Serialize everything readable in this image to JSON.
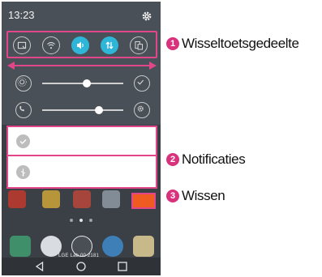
{
  "status_bar": {
    "time": "13:23"
  },
  "quick_settings": {
    "toggles": [
      {
        "icon": "screenshot-icon",
        "state": "off"
      },
      {
        "icon": "wifi-icon",
        "state": "off"
      },
      {
        "icon": "sound-icon",
        "state": "on"
      },
      {
        "icon": "data-sync-icon",
        "state": "on"
      },
      {
        "icon": "screen-rotation-icon",
        "state": "off"
      }
    ],
    "brightness_level": 0.55,
    "volume_level": 0.7
  },
  "home_screen": {
    "carrier": "LGE Lab 00 2181"
  },
  "callouts": [
    {
      "number": "1",
      "label": "Wisseltoetsgedeelte"
    },
    {
      "number": "2",
      "label": "Notificaties"
    },
    {
      "number": "3",
      "label": "Wissen"
    }
  ],
  "colors": {
    "highlight": "#e2468a",
    "toggle_on": "#2fb5d8",
    "clear_button": "#f05b22",
    "callout_badge": "#d8327c"
  }
}
